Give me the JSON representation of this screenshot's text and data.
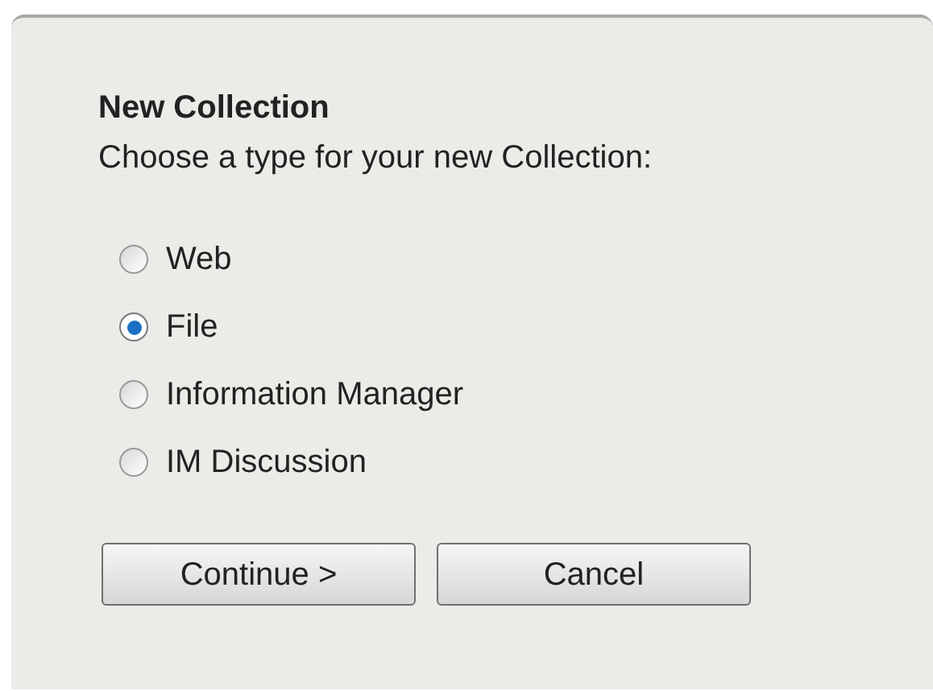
{
  "dialog": {
    "title": "New Collection",
    "prompt": "Choose a type for your new Collection:",
    "options": [
      {
        "label": "Web",
        "selected": false
      },
      {
        "label": "File",
        "selected": true
      },
      {
        "label": "Information Manager",
        "selected": false
      },
      {
        "label": "IM Discussion",
        "selected": false
      }
    ],
    "buttons": [
      "Continue >",
      "Cancel"
    ]
  }
}
